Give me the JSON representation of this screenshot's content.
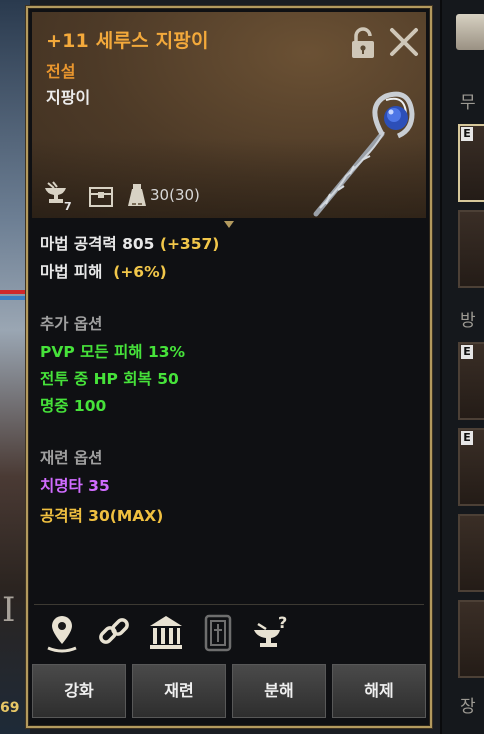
{
  "item": {
    "name": "+11 세루스 지팡이",
    "grade": "전설",
    "type": "지팡이",
    "enhance_badge": "7",
    "weight": "30(30)"
  },
  "stats": {
    "magic_attack": {
      "label": "마법 공격력 805",
      "bonus": "(+357)"
    },
    "magic_damage": {
      "label": "마법 피해",
      "bonus": "(+6%)"
    }
  },
  "extra_options": {
    "title": "추가 옵션",
    "lines": [
      "PVP 모든 피해 13%",
      "전투 중 HP 회복 50",
      "명중 100"
    ]
  },
  "reforge_options": {
    "title": "재련 옵션",
    "lines": [
      "치명타 35",
      "공격력 30(MAX)"
    ]
  },
  "buttons": [
    "강화",
    "재련",
    "분해",
    "해제"
  ],
  "background": {
    "right_sections": [
      "무",
      "방",
      "장"
    ],
    "left_number": "69",
    "left_roman": "I",
    "slot_badge": "E"
  },
  "icons": {
    "header": [
      "lock-icon",
      "close-icon",
      "enhance-anvil-icon",
      "chest-icon",
      "weight-icon"
    ],
    "bottom": [
      "location-pin-icon",
      "link-icon",
      "bank-icon",
      "seal-icon",
      "anvil-question-icon"
    ]
  },
  "colors": {
    "name": "#f3a93b",
    "bonus": "#f2c74a",
    "extra": "#46e23a",
    "reforge_crit": "#d06cff",
    "reforge_atk": "#f0c040"
  }
}
